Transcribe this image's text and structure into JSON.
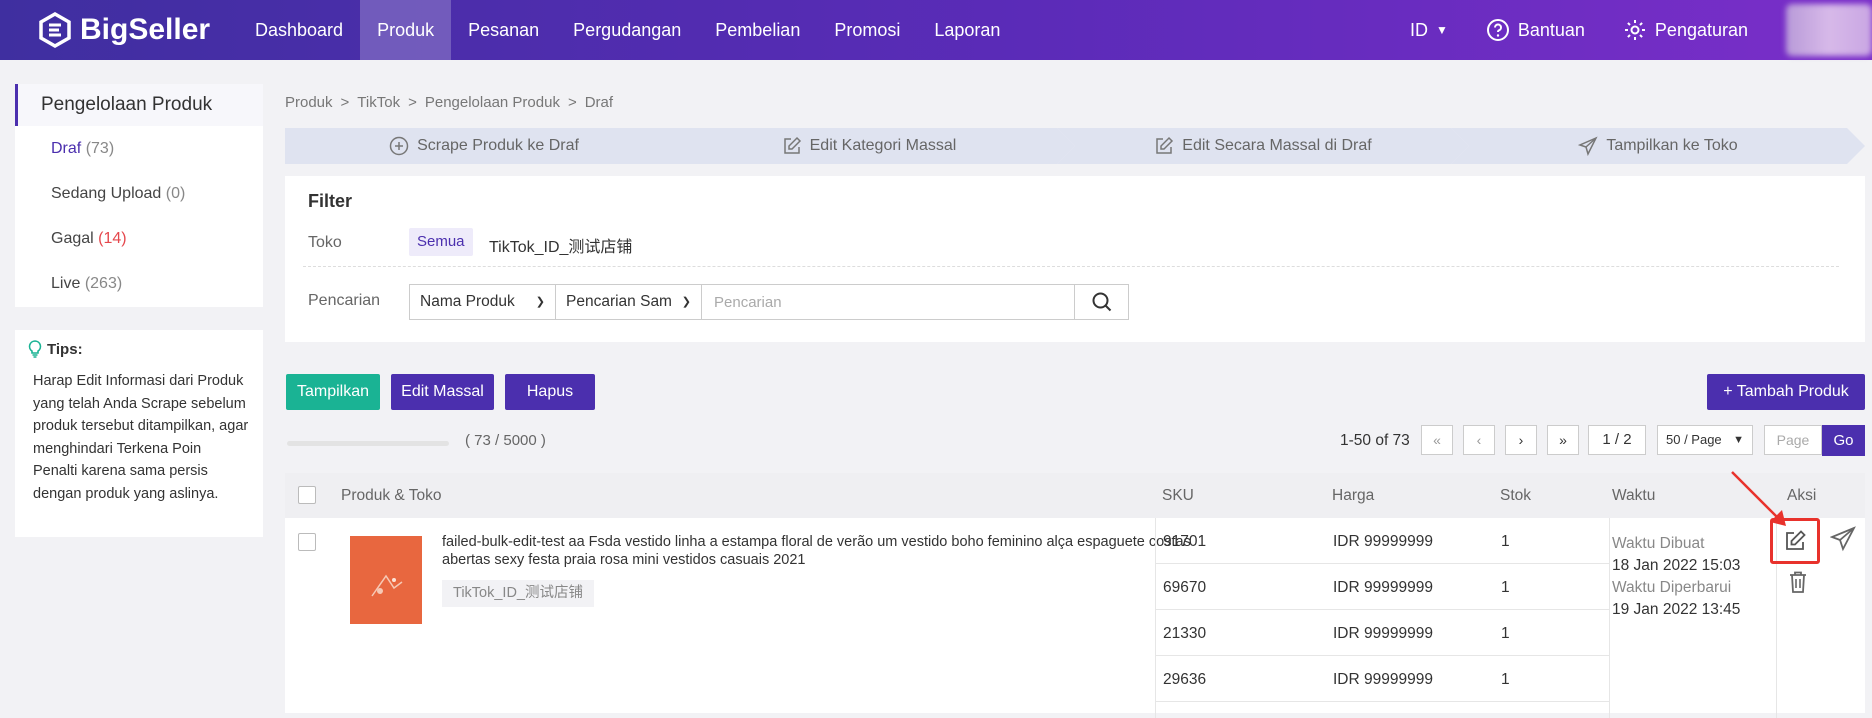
{
  "brand": {
    "name": "BigSeller"
  },
  "nav": {
    "items": [
      "Dashboard",
      "Produk",
      "Pesanan",
      "Pergudangan",
      "Pembelian",
      "Promosi",
      "Laporan"
    ],
    "active": "Produk"
  },
  "top_right": {
    "lang": "ID",
    "help": "Bantuan",
    "settings": "Pengaturan"
  },
  "sidebar": {
    "title": "Pengelolaan Produk",
    "items": [
      {
        "label": "Draf",
        "count": "(73)"
      },
      {
        "label": "Sedang Upload",
        "count": "(0)"
      },
      {
        "label": "Gagal",
        "count": "(14)"
      },
      {
        "label": "Live",
        "count": "(263)"
      }
    ]
  },
  "tips": {
    "title": "Tips:",
    "text": "Harap Edit Informasi dari Produk yang telah Anda Scrape sebelum produk tersebut ditampilkan, agar menghindari Terkena Poin Penalti karena sama persis dengan produk yang aslinya."
  },
  "breadcrumb": [
    "Produk",
    ">",
    "TikTok",
    ">",
    "Pengelolaan Produk",
    ">",
    "Draf"
  ],
  "steps": [
    "Scrape Produk ke Draf",
    "Edit Kategori Massal",
    "Edit Secara Massal di Draf",
    "Tampilkan ke Toko"
  ],
  "filter": {
    "title": "Filter",
    "store_label": "Toko",
    "store_all": "Semua",
    "store_name": "TikTok_ID_测试店铺",
    "search_label": "Pencarian",
    "search_field": "Nama Produk",
    "search_mode": "Pencarian Sama",
    "search_placeholder": "Pencarian"
  },
  "actions": {
    "display": "Tampilkan",
    "bulk_edit": "Edit Massal",
    "delete": "Hapus",
    "add_product": "+ Tambah Produk"
  },
  "quota": {
    "text": "( 73 / 5000 )",
    "used": 73,
    "max": 5000
  },
  "pagination": {
    "range": "1-50 of 73",
    "first": "«",
    "prev": "‹",
    "next": "›",
    "last": "»",
    "page": "1 / 2",
    "page_size": "50 / Page",
    "page_placeholder": "Page",
    "go": "Go"
  },
  "table": {
    "headers": {
      "product": "Produk & Toko",
      "sku": "SKU",
      "price": "Harga",
      "stock": "Stok",
      "time": "Waktu",
      "action": "Aksi"
    },
    "row": {
      "name": "failed-bulk-edit-test aa Fsda vestido linha a estampa floral de verão um vestido boho feminino alça espaguete costas abertas sexy festa praia rosa mini vestidos casuais 2021",
      "store": "TikTok_ID_测试店铺",
      "variants": [
        {
          "sku": "91701",
          "price": "IDR 99999999",
          "stock": "1"
        },
        {
          "sku": "69670",
          "price": "IDR 99999999",
          "stock": "1"
        },
        {
          "sku": "21330",
          "price": "IDR 99999999",
          "stock": "1"
        },
        {
          "sku": "29636",
          "price": "IDR 99999999",
          "stock": "1"
        }
      ],
      "created_label": "Waktu Dibuat",
      "created": "18 Jan 2022 15:03",
      "updated_label": "Waktu Diperbarui",
      "updated": "19 Jan 2022 13:45"
    }
  },
  "colors": {
    "primary": "#4b2fae",
    "green": "#1ab394",
    "highlight": "#e8322c"
  }
}
